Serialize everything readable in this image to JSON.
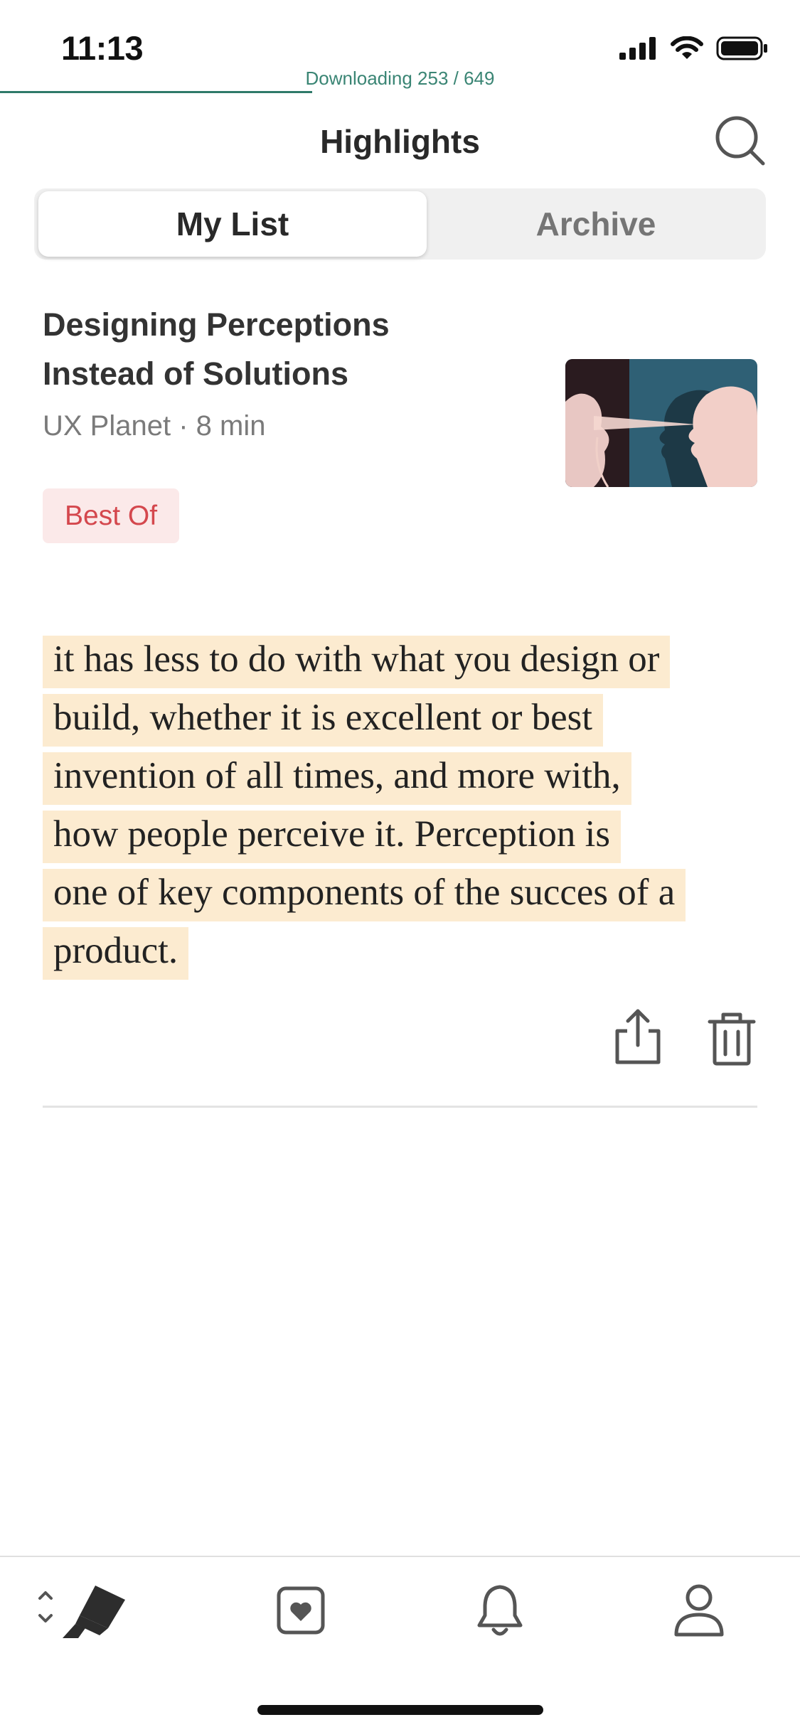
{
  "status_bar": {
    "time": "11:13"
  },
  "download": {
    "text": "Downloading 253 / 649",
    "current": 253,
    "total": 649
  },
  "header": {
    "title": "Highlights"
  },
  "segments": {
    "my_list": "My List",
    "archive": "Archive",
    "selected": "My List"
  },
  "article": {
    "title": "Designing Perceptions Instead of Solutions",
    "meta": "UX Planet · 8 min",
    "badge": "Best Of"
  },
  "highlight": {
    "lines": [
      "it has less to do with what you design or",
      "build, whether it is excellent or best",
      "invention of all times, and more with,",
      "how people perceive it. Perception is",
      "one of key components of the succes of a",
      "product."
    ]
  },
  "tabbar": {
    "items": [
      "highlighter-icon",
      "heart-bookmark-icon",
      "bell-icon",
      "profile-icon"
    ],
    "active": "highlighter-icon"
  },
  "colors": {
    "accent": "#2f7a69",
    "highlight_bg": "#fcebd0",
    "badge_bg": "#fbe9e9",
    "badge_text": "#d4474d"
  }
}
